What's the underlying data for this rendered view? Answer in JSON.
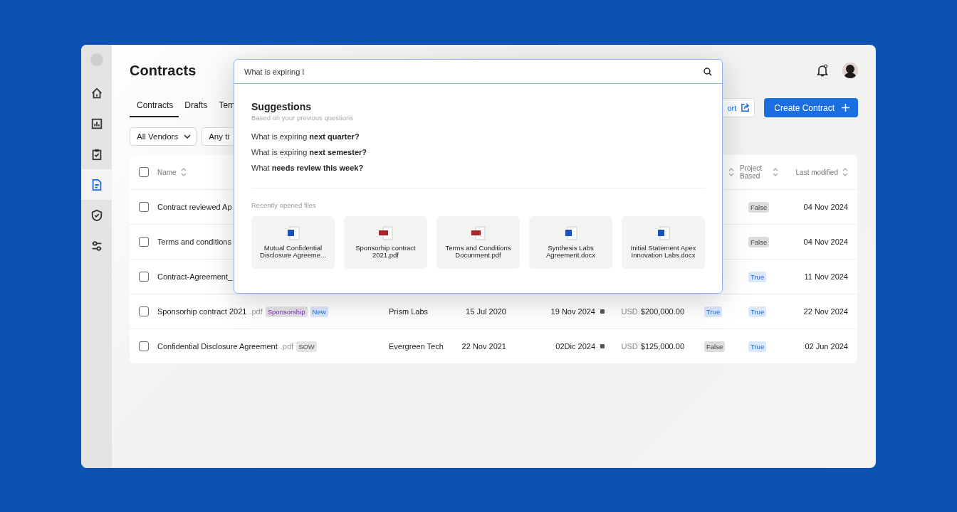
{
  "sidebar": {
    "items": [
      {
        "selected": false
      },
      {
        "selected": false
      },
      {
        "selected": false
      },
      {
        "selected": true
      },
      {
        "selected": false
      },
      {
        "selected": false
      }
    ]
  },
  "header": {
    "title": "Contracts"
  },
  "tabs": [
    {
      "label": "Contracts",
      "selected": true
    },
    {
      "label": "Drafts",
      "selected": false
    },
    {
      "label": "Tem",
      "selected": false
    }
  ],
  "actions": {
    "export": "ort",
    "create": "Create Contract"
  },
  "filters": [
    {
      "label": "All Vendors",
      "kind": "dropdown"
    },
    {
      "label": "Any ti",
      "kind": "plain"
    }
  ],
  "table": {
    "header_checked": false,
    "columns": {
      "name": "Name",
      "project_based": "Project Based",
      "last_modified": "Last modified"
    },
    "rows": [
      {
        "name": "Contract reviewed Ap",
        "project_based": {
          "text": "False",
          "on": false
        },
        "last_modified": "04 Nov 2024",
        "checked": false
      },
      {
        "name": "Terms and conditions",
        "project_based": {
          "text": "False",
          "on": false
        },
        "last_modified": "04 Nov 2024",
        "checked": false
      },
      {
        "name": "Contract-Agreement_",
        "project_based": {
          "text": "True",
          "on": true
        },
        "last_modified": "11 Nov 2024",
        "checked": false
      },
      {
        "name": "Sponsorhip contract 2021",
        "ext": ".pdf",
        "tags": [
          {
            "text": "Sponsorship",
            "kind": "category"
          },
          {
            "text": "New",
            "kind": "new"
          }
        ],
        "vendor": "Prism Labs",
        "execution_date": "15 Jul 2020",
        "expiration_date": "19 Nov 2024",
        "currency": "USD",
        "value": "$200,000.00",
        "auto_renew": {
          "text": "True",
          "on": true
        },
        "project_based": {
          "text": "True",
          "on": true
        },
        "last_modified": "22 Nov 2024",
        "checked": false
      },
      {
        "name": "Confidential Disclosure Agreement",
        "ext": ".pdf",
        "tags": [
          {
            "text": "SOW",
            "kind": "plain"
          }
        ],
        "vendor": "Evergreen Tech",
        "execution_date": "22 Nov 2021",
        "expiration_date": "02Dic 2024",
        "currency": "USD",
        "value": "$125,000.00",
        "auto_renew": {
          "text": "False",
          "on": false
        },
        "project_based": {
          "text": "True",
          "on": true
        },
        "last_modified": "02 Jun 2024",
        "checked": false
      }
    ]
  },
  "search": {
    "value": "What is expiring I",
    "suggestions_title": "Suggestions",
    "suggestions_subtitle": "Based on your previous questions",
    "suggestions": [
      "What is expiring **next quarter?**",
      "What is expiring **next semester?**",
      "What **needs review this week?**"
    ],
    "recent_title": "Recently opened files",
    "recent_files": [
      {
        "name": "Mutual Confidential Disclosure Agreeme...",
        "kind": "word"
      },
      {
        "name": "Sponsorhip contract 2021.pdf",
        "kind": "pdf"
      },
      {
        "name": "Terms and Conditions Docunment.pdf",
        "kind": "pdf"
      },
      {
        "name": "Synthesis Labs Agreement.docx",
        "kind": "word"
      },
      {
        "name": "Initial Statement Apex Innovation Labs.docx",
        "kind": "word"
      }
    ]
  }
}
